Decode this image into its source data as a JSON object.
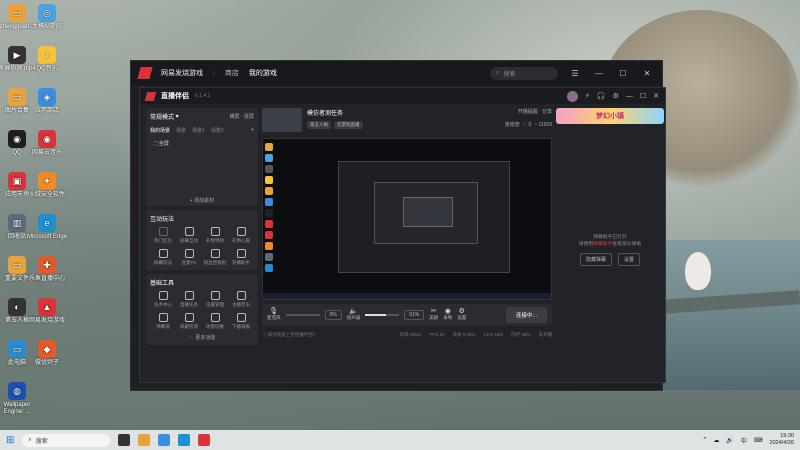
{
  "desktop": {
    "icons": [
      {
        "label": "chengguan...",
        "color": "#e8a33a",
        "glyph": "▭"
      },
      {
        "label": "大模AI提问",
        "color": "#4aa3e0",
        "glyph": "◎"
      },
      {
        "label": "多屏协同.mp4",
        "color": "#333333",
        "glyph": "▶"
      },
      {
        "label": "QQ音乐",
        "color": "#f5c338",
        "glyph": "♪"
      },
      {
        "label": "图片合集",
        "color": "#e8a33a",
        "glyph": "▭"
      },
      {
        "label": "应用商店",
        "color": "#3b8de0",
        "glyph": "◈"
      },
      {
        "label": "QQ",
        "color": "#1e1e1e",
        "glyph": "◉"
      },
      {
        "label": "网易云音乐",
        "color": "#d8343a",
        "glyph": "◉"
      },
      {
        "label": "应用市场",
        "color": "#d8343a",
        "glyph": "▣"
      },
      {
        "label": "火绒安全软件",
        "color": "#f08a24",
        "glyph": "✦"
      },
      {
        "label": "回收站",
        "color": "#5a6c7c",
        "glyph": "▥"
      },
      {
        "label": "Microsoft Edge",
        "color": "#1e8fd0",
        "glyph": "e"
      },
      {
        "label": "重要文件",
        "color": "#e8a33a",
        "glyph": "▭"
      },
      {
        "label": "乐鱼直播中心",
        "color": "#e05a2a",
        "glyph": "✚"
      },
      {
        "label": "第五人格",
        "color": "#333333",
        "glyph": "◐"
      },
      {
        "label": "网易发烧游戏",
        "color": "#d8343a",
        "glyph": "▲"
      },
      {
        "label": "此电脑",
        "color": "#2b8bd0",
        "glyph": "▭"
      },
      {
        "label": "做优师子",
        "color": "#e55a2a",
        "glyph": "◆"
      },
      {
        "label": "Wallpaper Engine: ...",
        "color": "#1d4fb0",
        "glyph": "◍"
      }
    ]
  },
  "window": {
    "app_name": "网易发烧游戏",
    "nav": [
      "商店",
      "我的游戏"
    ],
    "search_placeholder": "搜索",
    "controls": [
      "☰",
      "—",
      "☐",
      "✕"
    ]
  },
  "live_app": {
    "title": "直播伴侣",
    "version": "6.1.4.1",
    "header_right": [
      "⚡",
      "🎧",
      "⚙",
      "—",
      "☐",
      "✕"
    ],
    "scenes": {
      "header": "常规模式",
      "header_right": "横屏 · 竖屏",
      "tabs": [
        "我的场景",
        "场景",
        "场景1",
        "场景2",
        "+"
      ],
      "item": "全屏",
      "add_source": "+ 添加素材"
    },
    "interactive": {
      "title": "互动玩法",
      "tools": [
        "热门红包",
        "屏幕互动",
        "礼物特效",
        "礼物心愿",
        "屏幕玩法",
        "连麦PK",
        "粉丝团福利",
        "开播助手"
      ]
    },
    "basic": {
      "title": "基础工具",
      "tools": [
        "任务中心",
        "直播任务",
        "设置管理",
        "主播音乐",
        "弹幕墙",
        "屏蔽检测",
        "场景切换",
        "下播海报"
      ],
      "more": "更多功能"
    },
    "room": {
      "title": "模仿者测任务",
      "tags": [
        "第五人格",
        "云游戏直播"
      ],
      "announce": "开播提醒",
      "share": "分享",
      "fans": "金铭管",
      "likes": "0",
      "viewers": "11929"
    },
    "controls": {
      "mic_label": "麦克风",
      "mic_pct": "0%",
      "mic_level": 0,
      "speaker_label": "扬声器",
      "speaker_pct": "61%",
      "speaker_level": 0.61,
      "icons": [
        {
          "g": "✂",
          "t": "美颜"
        },
        {
          "g": "◉",
          "t": "录制"
        },
        {
          "g": "⚙",
          "t": "设置"
        }
      ],
      "start": "连接中..."
    },
    "status": {
      "left": "ⓘ 如何快速上手直播伴侣？",
      "items": [
        "码率 0Kb/s",
        "FPS 30",
        "丢帧 0.00%",
        "CPU 18%",
        "内存 48%",
        "未开播"
      ]
    },
    "right": {
      "banner": "梦幻小镇",
      "danmu_line1": "弹幕助手已打开",
      "danmu_line2_a": "请使用",
      "danmu_line2_red": "弹幕助手",
      "danmu_line2_b": "查看观众弹幕",
      "btn1": "隐藏弹幕",
      "btn2": "设置"
    }
  },
  "taskbar": {
    "search": "搜索",
    "tray": [
      "^",
      "☁",
      "🔊",
      "中",
      "⌨"
    ],
    "time": "19:30",
    "date": "2024/4/26"
  }
}
